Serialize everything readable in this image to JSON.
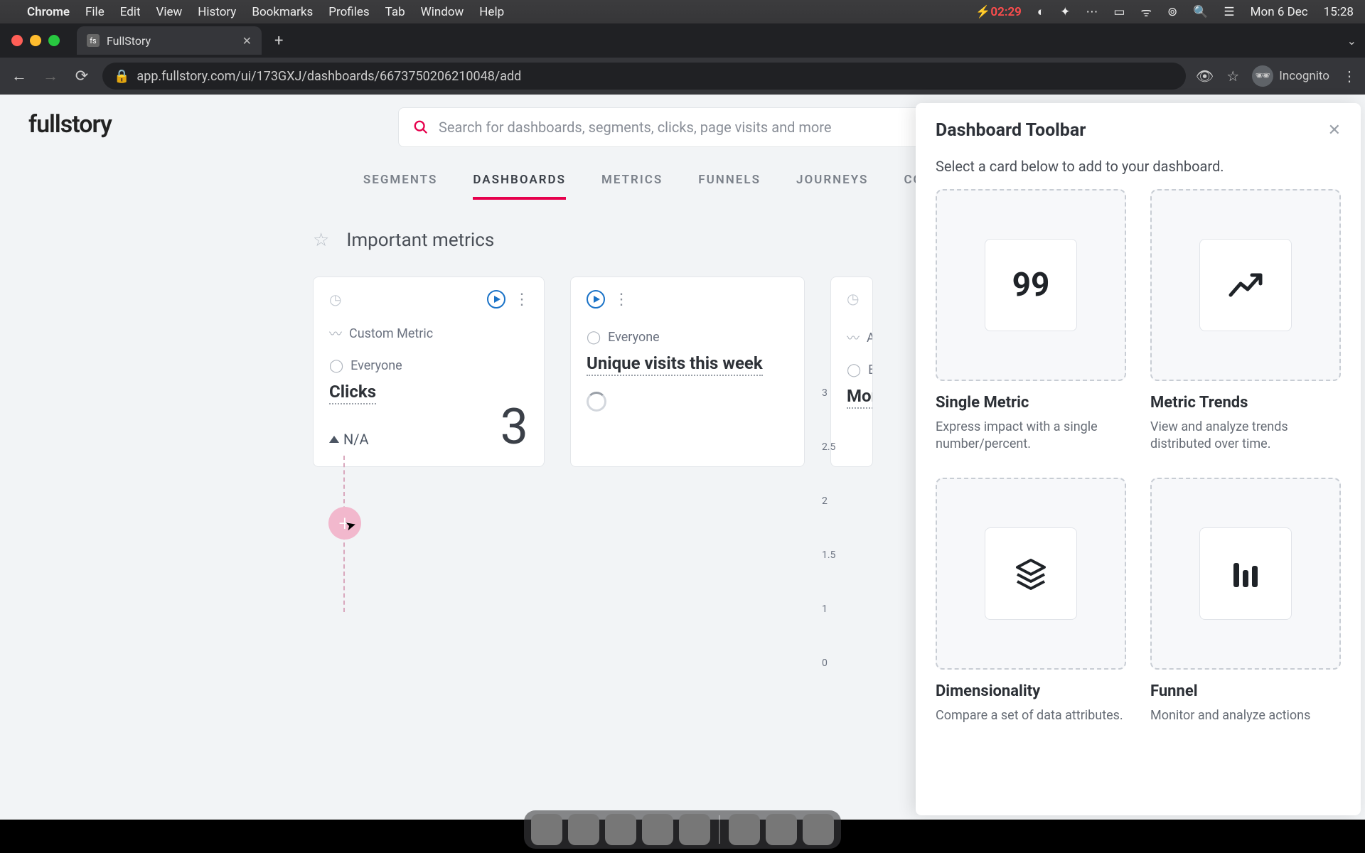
{
  "menubar": {
    "app": "Chrome",
    "items": [
      "File",
      "Edit",
      "View",
      "History",
      "Bookmarks",
      "Profiles",
      "Tab",
      "Window",
      "Help"
    ],
    "battery": "02:29",
    "date": "Mon 6 Dec",
    "time": "15:28"
  },
  "browser": {
    "tab_title": "FullStory",
    "favicon_text": "fs",
    "url": "app.fullstory.com/ui/173GXJ/dashboards/6673750206210048/add",
    "incognito_label": "Incognito"
  },
  "app": {
    "logo": "fullstory",
    "search_placeholder": "Search for dashboards, segments, clicks, page visits and more",
    "nav": [
      "SEGMENTS",
      "DASHBOARDS",
      "METRICS",
      "FUNNELS",
      "JOURNEYS",
      "CONVERSIONS"
    ],
    "nav_active_index": 1,
    "dashboard_title": "Important metrics",
    "cards": {
      "clicks": {
        "metric_type": "Custom Metric",
        "segment": "Everyone",
        "title": "Clicks",
        "value": "3",
        "delta": "N/A"
      },
      "unique": {
        "segment": "Everyone",
        "title": "Unique visits this week"
      },
      "monthly_peek": {
        "letter": "A",
        "seg_prefix": "E",
        "title_prefix": "Mon"
      }
    },
    "chart_axis": [
      "3",
      "2.5",
      "2",
      "1.5",
      "1",
      "0"
    ]
  },
  "panel": {
    "title": "Dashboard Toolbar",
    "subtitle": "Select a card below to add to your dashboard.",
    "tiles": [
      {
        "glyph": "99",
        "title": "Single Metric",
        "desc": "Express impact with a single number/percent."
      },
      {
        "glyph": "trend",
        "title": "Metric Trends",
        "desc": "View and analyze trends distributed over time."
      },
      {
        "glyph": "stack",
        "title": "Dimensionality",
        "desc": "Compare a set of data attributes."
      },
      {
        "glyph": "bars",
        "title": "Funnel",
        "desc": "Monitor and analyze actions"
      }
    ]
  }
}
